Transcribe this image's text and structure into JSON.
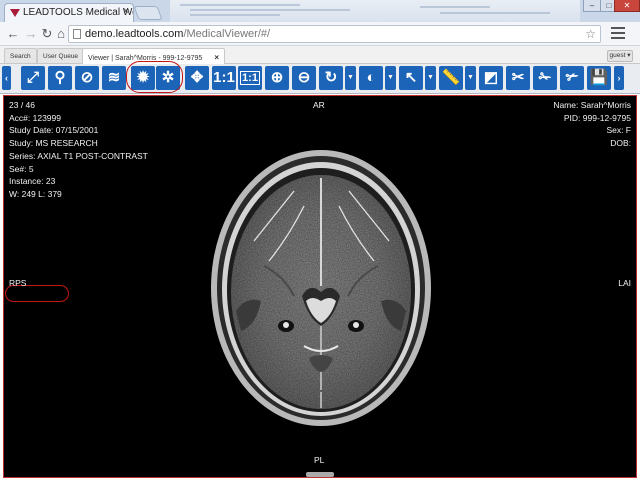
{
  "browser": {
    "tab_title": "LEADTOOLS Medical Web",
    "url_host": "demo.leadtools.com",
    "url_path": "/MedicalViewer/#/"
  },
  "app_tabs": [
    {
      "label": "Search"
    },
    {
      "label": "User Queue"
    },
    {
      "label": "Viewer | Sarah^Morris - 999-12-9795"
    }
  ],
  "guest_menu": "guest ▾",
  "toolbar": {
    "scroll_left_icon": "chevron-left-icon",
    "one_to_one_label": "1:1",
    "tools": [
      "fit-image-icon",
      "magnify-icon",
      "zoom-search-icon",
      "stack-layers-icon",
      "bug-icon",
      "bug-settings-icon",
      "move-arrows-icon",
      "one-to-one-icon",
      "actual-size-icon",
      "zoom-in-icon",
      "zoom-out-icon",
      "rotate-icon",
      "window-level-icon",
      "select-arrow-icon",
      "ruler-icon",
      "annotation-icon",
      "cut-icon",
      "scissors-icon",
      "scissors-alt-icon",
      "save-icon"
    ]
  },
  "overlay": {
    "top_left": [
      "23 / 46",
      "Acc#: 123999",
      "Study Date: 07/15/2001",
      "Study: MS RESEARCH",
      "Series: AXIAL T1 POST-CONTRAST",
      "Se#: 5",
      "Instance: 23",
      "W: 249 L: 379"
    ],
    "top_right": [
      "Name: Sarah^Morris",
      "PID: 999-12-9795",
      "Sex: F",
      "DOB:"
    ],
    "orientation": {
      "top": "AR",
      "bottom": "PL",
      "left": "RPS",
      "right": "LAI"
    }
  },
  "colors": {
    "accent": "#1c64b8",
    "highlight_ring": "#c41616",
    "viewer_bg": "#000000"
  }
}
